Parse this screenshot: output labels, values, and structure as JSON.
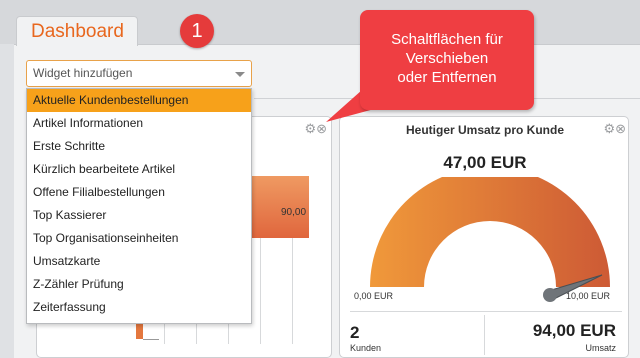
{
  "tab": {
    "label": "Dashboard"
  },
  "badge": {
    "number": "1"
  },
  "callout": {
    "line1": "Schaltflächen für",
    "line2": "Verschieben",
    "line3": "oder Entfernen"
  },
  "widget_selector": {
    "placeholder": "Widget hinzufügen",
    "options": [
      "Aktuelle Kundenbestellungen",
      "Artikel Informationen",
      "Erste Schritte",
      "Kürzlich bearbeitete Artikel",
      "Offene Filialbestellungen",
      "Top Kassierer",
      "Top Organisationseinheiten",
      "Umsatzkarte",
      "Z-Zähler Prüfung",
      "Zeiterfassung"
    ],
    "highlighted_index": 0
  },
  "left_widget": {
    "bar_value_label": "90,00",
    "controls": "⚙⊗"
  },
  "right_widget": {
    "title": "Heutiger Umsatz pro Kunde",
    "controls": "⚙⊗",
    "amount": "47,00 EUR",
    "gauge_min": "0,00 EUR",
    "gauge_max": "10,00 EUR",
    "customers_value": "2",
    "customers_label": "Kunden",
    "revenue_value": "94,00 EUR",
    "revenue_label": "Umsatz"
  },
  "colors": {
    "accent": "#e8671e",
    "highlight": "#f7a11a",
    "callout": "#ef3e42"
  }
}
